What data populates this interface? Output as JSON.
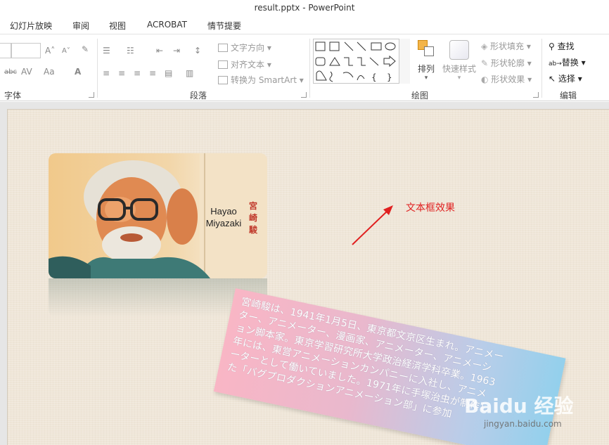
{
  "window": {
    "title": "result.pptx - PowerPoint"
  },
  "tabs": [
    "幻灯片放映",
    "审阅",
    "视图",
    "ACROBAT",
    "情节提要"
  ],
  "ribbon": {
    "font_group": {
      "label": "字体"
    },
    "paragraph_group": {
      "label": "段落",
      "text_direction": "文字方向",
      "align_text": "对齐文本",
      "convert_smartart": "转换为 SmartArt"
    },
    "drawing_group": {
      "label": "绘图",
      "arrange": "排列",
      "quick_styles": "快速样式",
      "shape_fill": "形状填充",
      "shape_outline": "形状轮廓",
      "shape_effects": "形状效果"
    },
    "editing_group": {
      "label": "编辑",
      "find": "查找",
      "replace": "替换",
      "select": "选择"
    }
  },
  "slide": {
    "photo_card": {
      "name_en_line1": "Hayao",
      "name_en_line2": "Miyazaki",
      "name_jp": "宮崎駿"
    },
    "annotation": "文本框效果",
    "textbox": [
      "宮崎駿は、1941年1月5日、東京都文京区生まれ。アニメー",
      "ター、アニメーター、漫画家、アニメーター、アニメーシ",
      "ョン脚本家。東京学習研究所大学政治経済学科卒業。1963",
      "年には、東営アニメーションカンパニーに入社し、アニメ",
      "ーターとして働いていました。1971年に手塚治虫が制作し",
      "た「バグプロダクションアニメーション部」に参加"
    ],
    "watermark": "Baidu 经验",
    "watermark_url": "jingyan.baidu.com"
  },
  "colors": {
    "annotation_red": "#e02020",
    "name_jp_red": "#c0392b",
    "slide_bg": "#efe6d8",
    "textbox_gradient_start": "#f9b6c5",
    "textbox_gradient_end": "#93d0ec"
  }
}
